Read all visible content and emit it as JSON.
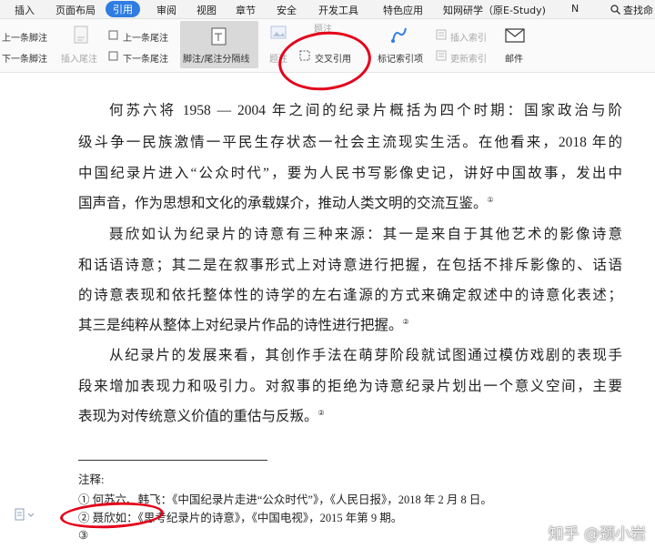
{
  "ribbon": {
    "tabs": [
      "插入",
      "页面布局",
      "引用",
      "审阅",
      "视图",
      "章节",
      "安全",
      "开发工具",
      "特色应用",
      "知网研学（原E-Study)",
      "N"
    ],
    "search_label": "查找命"
  },
  "toolbar": {
    "prev_footnote": "上一条脚注",
    "next_footnote": "下一条脚注",
    "insert_endnote": "插入尾注",
    "prev_endnote": "上一条尾注",
    "next_endnote": "下一条尾注",
    "separator": "脚注/尾注分隔线",
    "caption_top": "题注",
    "caption": "题注",
    "cross_ref": "交叉引用",
    "mark_index": "标记索引项",
    "insert_index": "插入索引",
    "update_index": "更新索引",
    "mail": "邮件"
  },
  "document": {
    "p1": [
      "何苏六将 1958 — 2004 年之间的纪录片概括为四个时期：国家政治与阶",
      "级斗争一民族激情一平民生存状态一社会主流现实生活。在他看来，2018 年的",
      "中国纪录片进入“公众时代”，要为人民书写影像史记，讲好中国故事，发出中",
      "国声音，作为思想和文化的承载媒介，推动人类文明的交流互鉴。"
    ],
    "p2": [
      "聂欣如认为纪录片的诗意有三种来源：其一是来自于其他艺术的影像诗意",
      "和话语诗意；其二是在叙事形式上对诗意进行把握，在包括不排斥影像的、话语",
      "的诗意表现和依托整体性的诗学的左右逢源的方式来确定叙述中的诗意化表述；",
      "其三是纯粹从整体上对纪录片作品的诗性进行把握。"
    ],
    "p3": [
      "从纪录片的发展来看，其创作手法在萌芽阶段就试图通过模仿戏剧的表现手",
      "段来增加表现力和吸引力。对叙事的拒绝为诗意纪录片划出一个意义空间，主要",
      "表现为对传统意义价值的重估与反叛。"
    ],
    "marks": [
      "①",
      "②",
      "②"
    ]
  },
  "footnotes": {
    "heading": "注释:",
    "items": [
      "①  何苏六、韩飞：《中国纪录片走进“公众时代”》，《人民日报》，2018 年 2 月 8 日。",
      "②  聂欣如：《思考纪录片的诗意》，《中国电视》，2015 年第 9 期。",
      "③"
    ]
  },
  "watermark": "知乎 @颈小岩",
  "colors": {
    "accent": "#2f7de1",
    "annotation": "#e4001a"
  }
}
